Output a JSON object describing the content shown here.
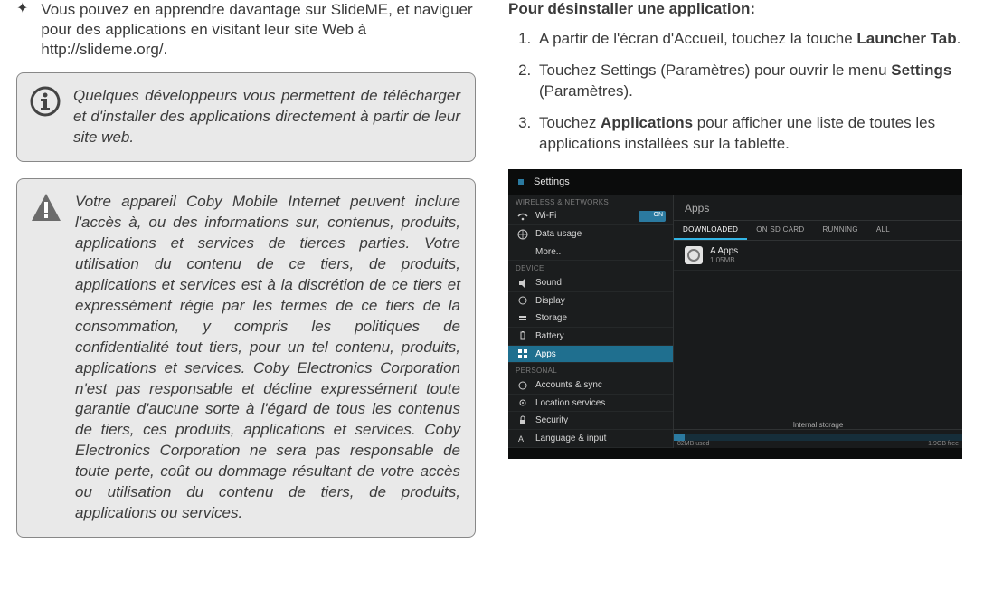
{
  "left": {
    "bullet": "Vous pouvez en apprendre davantage sur SlideME, et naviguer pour des applications en visitant leur site Web à http://slideme.org/.",
    "info": "Quelques développeurs vous permettent de télécharger et d'installer des applications directement à partir de leur site web.",
    "warn": "Votre appareil Coby Mobile Internet peuvent inclure l'accès à, ou des informations sur, contenus, produits, applications et services de tierces parties. Votre utilisation du contenu de ce tiers, de produits, applications et services est à la discrétion de ce tiers et expressément régie par les termes de ce tiers de la consommation, y compris les politiques de confidentialité tout tiers, pour un tel contenu, produits, applications et services. Coby Electronics Corporation n'est pas responsable et décline expressément toute garantie d'aucune sorte à l'égard de tous les contenus de tiers, ces produits, applications et services. Coby Electronics Corporation ne sera pas responsable de toute perte, coût ou dommage résultant de votre accès ou utilisation du contenu de tiers, de produits, applications ou services."
  },
  "right": {
    "heading": "Pour désinstaller une application:",
    "step1_a": "A partir de l'écran d'Accueil, touchez la touche ",
    "step1_b": "Launcher Tab",
    "step1_c": ".",
    "step2_a": "Touchez Settings (Paramètres) pour ouvrir le menu ",
    "step2_b": "Settings",
    "step2_c": " (Paramètres).",
    "step3_a": "Touchez ",
    "step3_b": "Applications",
    "step3_c": " pour afficher une liste de toutes les applications installées sur la tablette."
  },
  "android": {
    "title": "Settings",
    "cat_wireless": "WIRELESS & NETWORKS",
    "cat_device": "DEVICE",
    "cat_personal": "PERSONAL",
    "items": {
      "wifi": "Wi-Fi",
      "data": "Data usage",
      "more": "More..",
      "sound": "Sound",
      "display": "Display",
      "storage": "Storage",
      "battery": "Battery",
      "apps": "Apps",
      "accounts": "Accounts & sync",
      "location": "Location services",
      "security": "Security",
      "language": "Language & input"
    },
    "main_header": "Apps",
    "tabs": {
      "downloaded": "DOWNLOADED",
      "sdcard": "ON SD CARD",
      "running": "RUNNING",
      "all": "ALL"
    },
    "app": {
      "name": "A Apps",
      "size": "1.05MB"
    },
    "storage": {
      "label": "Internal storage",
      "used": "82MB used",
      "free": "1.9GB free"
    }
  }
}
